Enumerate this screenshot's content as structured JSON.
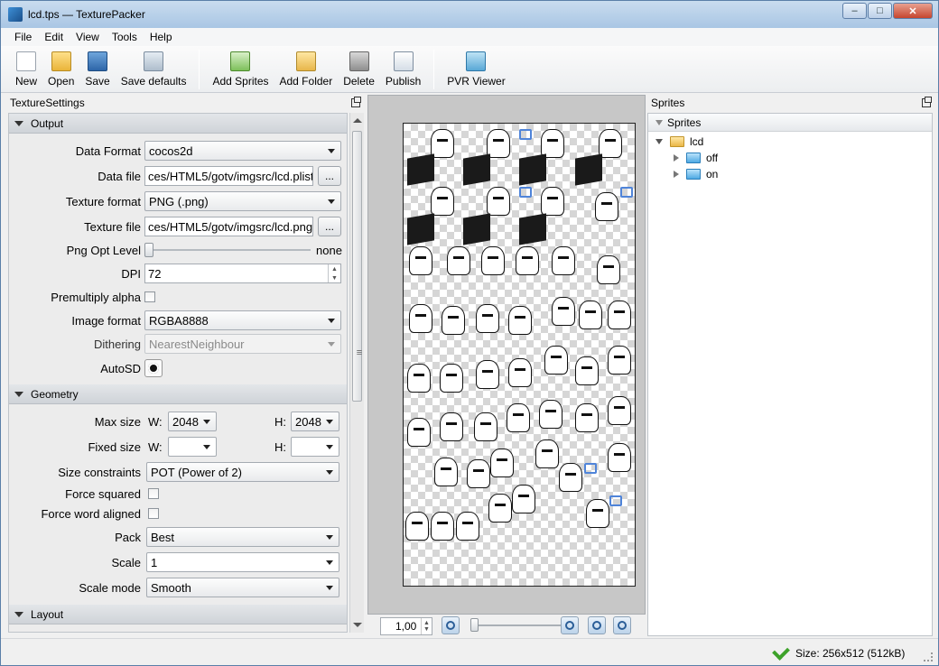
{
  "window": {
    "title": "lcd.tps — TexturePacker",
    "controls": {
      "minimize": "–",
      "maximize": "□",
      "close": "✕"
    }
  },
  "menu": [
    "File",
    "Edit",
    "View",
    "Tools",
    "Help"
  ],
  "toolbar": {
    "new": "New",
    "open": "Open",
    "save": "Save",
    "save_defaults": "Save defaults",
    "add_sprites": "Add Sprites",
    "add_folder": "Add Folder",
    "delete": "Delete",
    "publish": "Publish",
    "pvr_viewer": "PVR Viewer"
  },
  "texture_settings": {
    "panel_title": "TextureSettings",
    "output": {
      "section": "Output",
      "data_format_label": "Data Format",
      "data_format": "cocos2d",
      "data_file_label": "Data file",
      "data_file": "ces/HTML5/gotv/imgsrc/lcd.plist",
      "texture_format_label": "Texture format",
      "texture_format": "PNG (.png)",
      "texture_file_label": "Texture file",
      "texture_file": "ces/HTML5/gotv/imgsrc/lcd.png",
      "browse": "...",
      "png_opt_label": "Png Opt Level",
      "png_opt_value": "none",
      "dpi_label": "DPI",
      "dpi": "72",
      "premultiply_label": "Premultiply alpha",
      "image_format_label": "Image format",
      "image_format": "RGBA8888",
      "dithering_label": "Dithering",
      "dithering": "NearestNeighbour",
      "autosd_label": "AutoSD"
    },
    "geometry": {
      "section": "Geometry",
      "max_size_label": "Max size",
      "w_label": "W:",
      "h_label": "H:",
      "max_w": "2048",
      "max_h": "2048",
      "fixed_size_label": "Fixed size",
      "size_constraints_label": "Size constraints",
      "size_constraints": "POT (Power of 2)",
      "force_squared_label": "Force squared",
      "force_word_label": "Force word aligned",
      "pack_label": "Pack",
      "pack": "Best",
      "scale_label": "Scale",
      "scale": "1",
      "scale_mode_label": "Scale mode",
      "scale_mode": "Smooth"
    },
    "layout": {
      "section": "Layout"
    }
  },
  "preview": {
    "zoom": "1,00"
  },
  "sprites": {
    "panel_title": "Sprites",
    "header": "Sprites",
    "tree": [
      {
        "label": "lcd",
        "children": [
          "off",
          "on"
        ]
      }
    ]
  },
  "status": {
    "text": "Size: 256x512 (512kB)"
  },
  "colors": {
    "ok": "#3da22a",
    "folder_root": "#eab747",
    "folder_child": "#4ea9e3"
  }
}
